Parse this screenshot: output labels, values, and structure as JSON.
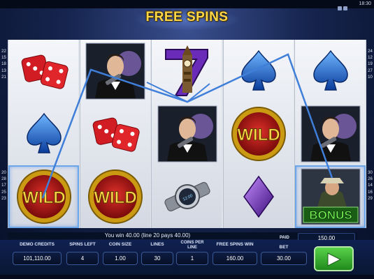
{
  "header": {
    "title": "FREE SPINS",
    "clock": "18:30"
  },
  "reels": [
    [
      "dice",
      "spade",
      "wild"
    ],
    [
      "agent",
      "dice",
      "wild"
    ],
    [
      "seven-big-ben",
      "agent",
      "watch"
    ],
    [
      "spade",
      "wild",
      "diamond"
    ],
    [
      "spade",
      "agent",
      "bonus"
    ]
  ],
  "symbol_labels": {
    "wild": "WILD",
    "bonus": "BONUS"
  },
  "line_numbers": {
    "left_top": [
      "22",
      "15",
      "18",
      "13",
      "21",
      "",
      "",
      "",
      "",
      "",
      "",
      "",
      "",
      "",
      "",
      "",
      "",
      "",
      "",
      ""
    ],
    "left_bottom": [
      "20",
      "28",
      "17",
      "25",
      "23"
    ],
    "right_top": [
      "24",
      "12",
      "19",
      "27",
      "10",
      "",
      "",
      "",
      "",
      "",
      "",
      "",
      "",
      "",
      "",
      "",
      "",
      "",
      "",
      ""
    ],
    "right_bottom": [
      "30",
      "26",
      "14",
      "16",
      "29"
    ]
  },
  "win_message": "You win  40.00 (line 20 pays  40.00)",
  "paid": {
    "label": "PAID",
    "value": "150.00"
  },
  "stats": {
    "demo_credits": {
      "label": "DEMO CREDITS",
      "value": "101,110.00"
    },
    "spins_left": {
      "label": "SPINS LEFT",
      "value": "4"
    },
    "coin_size": {
      "label": "COIN SIZE",
      "value": "1.00"
    },
    "lines": {
      "label": "LINES",
      "value": "30"
    },
    "coins_per_line": {
      "label": "COINS PER LINE",
      "value": "1"
    },
    "free_spins_win": {
      "label": "FREE SPINS WIN",
      "value": "160.00"
    },
    "bet": {
      "label": "BET",
      "value": "30.00"
    }
  },
  "colors": {
    "title": "#ffd84a",
    "reel_bg": "#e6e9ef",
    "panel": "#0f2150",
    "play": "#3cb534",
    "payline": "#3f7fd9"
  },
  "buttons": {
    "play_icon": "play-icon"
  }
}
